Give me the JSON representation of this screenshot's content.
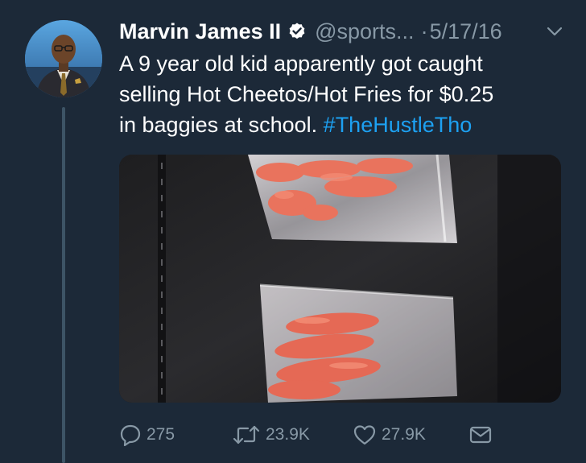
{
  "tweet": {
    "author": {
      "display_name": "Marvin James II",
      "verified": true,
      "handle": "@sports...",
      "avatar_icon": "profile-photo"
    },
    "separator": "·",
    "date": "5/17/16",
    "text_lines": [
      "A 9 year old kid apparently got caught",
      "selling Hot Cheetos/Hot Fries for $0.25",
      "in baggies at school. "
    ],
    "hashtag": "#TheHustleTho",
    "media": {
      "icon": "photo-cheetos-in-baggies"
    },
    "actions": {
      "reply_count": "275",
      "retweet_count": "23.9K",
      "like_count": "27.9K"
    },
    "colors": {
      "background": "#1c2938",
      "text": "#ffffff",
      "muted": "#8899a6",
      "link": "#1da1f2",
      "thread_line": "#3d5466"
    }
  }
}
